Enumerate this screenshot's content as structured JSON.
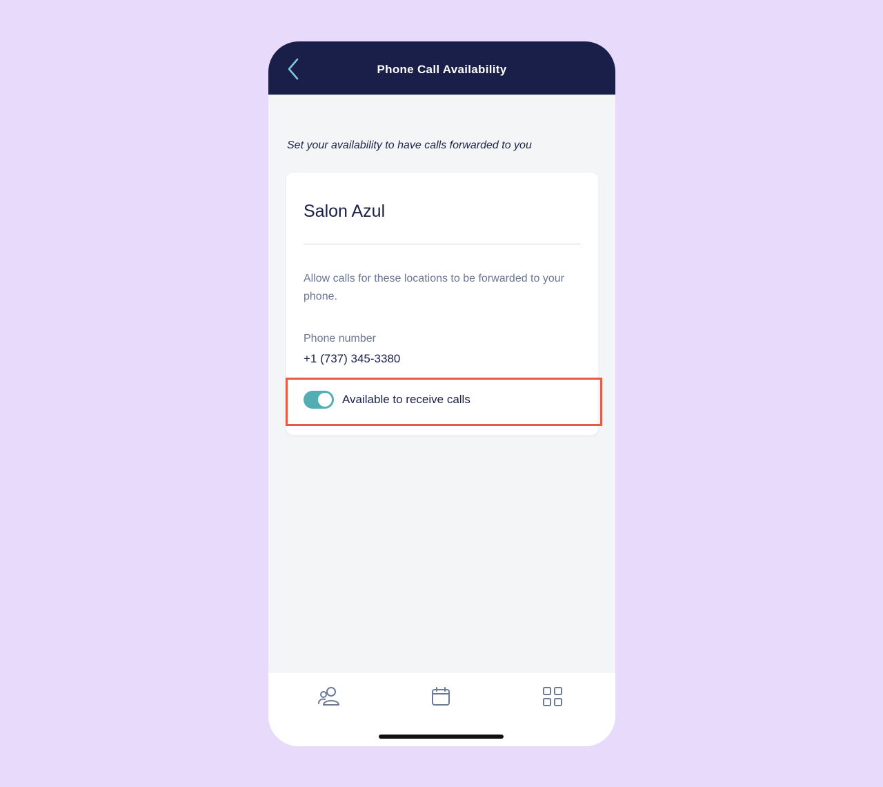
{
  "header": {
    "title": "Phone Call Availability",
    "back_icon": "chevron-left-icon"
  },
  "subtitle": "Set your availability to have calls forwarded to you",
  "card": {
    "title": "Salon Azul",
    "description": "Allow calls for these locations to be forwarded to your phone.",
    "phone_label": "Phone number",
    "phone_value": "+1 (737) 345-3380",
    "toggle_label": "Available to receive calls",
    "toggle_on": true
  },
  "tabbar": {
    "tabs": [
      {
        "icon": "clients-icon"
      },
      {
        "icon": "calendar-icon"
      },
      {
        "icon": "grid-icon"
      }
    ]
  },
  "colors": {
    "header_bg": "#1a1f4a",
    "accent": "#53aeb4",
    "background": "#e8dafa",
    "highlight": "#e65a47"
  }
}
